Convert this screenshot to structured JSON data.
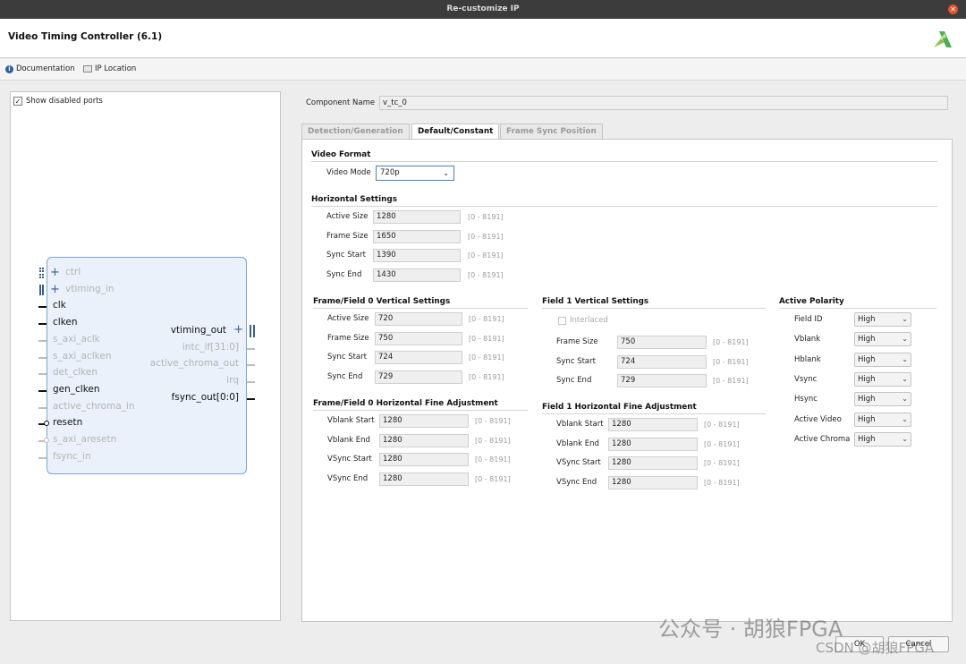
{
  "window": {
    "title": "Re-customize IP",
    "close_glyph": "✕"
  },
  "header": {
    "ip_title": "Video Timing Controller (6.1)"
  },
  "links": {
    "documentation": "Documentation",
    "ip_location": "IP Location",
    "info_glyph": "i"
  },
  "left": {
    "show_disabled_ports": "Show disabled ports",
    "checkbox_glyph": "✓",
    "ports_left": [
      {
        "name": "ctrl",
        "enabled": false,
        "plus": true
      },
      {
        "name": "vtiming_in",
        "enabled": false,
        "plus": true
      },
      {
        "name": "clk",
        "enabled": true
      },
      {
        "name": "clken",
        "enabled": true
      },
      {
        "name": "s_axi_aclk",
        "enabled": false
      },
      {
        "name": "s_axi_aclken",
        "enabled": false
      },
      {
        "name": "det_clken",
        "enabled": false
      },
      {
        "name": "gen_clken",
        "enabled": true
      },
      {
        "name": "active_chroma_in",
        "enabled": false
      },
      {
        "name": "resetn",
        "enabled": true
      },
      {
        "name": "s_axi_aresetn",
        "enabled": false
      },
      {
        "name": "fsync_in",
        "enabled": false
      }
    ],
    "ports_right": [
      {
        "name": "vtiming_out",
        "enabled": true
      },
      {
        "name": "intc_if[31:0]",
        "enabled": false
      },
      {
        "name": "active_chroma_out",
        "enabled": false
      },
      {
        "name": "irq",
        "enabled": false
      },
      {
        "name": "fsync_out[0:0]",
        "enabled": true
      }
    ]
  },
  "component": {
    "label": "Component Name",
    "value": "v_tc_0"
  },
  "tabs": [
    "Detection/Generation",
    "Default/Constant",
    "Frame Sync Position"
  ],
  "video_format": {
    "title": "Video Format",
    "mode_label": "Video Mode",
    "mode_value": "720p"
  },
  "horizontal": {
    "title": "Horizontal Settings",
    "rows": [
      {
        "label": "Active Size",
        "value": "1280",
        "range": "[0 - 8191]"
      },
      {
        "label": "Frame Size",
        "value": "1650",
        "range": "[0 - 8191]"
      },
      {
        "label": "Sync Start",
        "value": "1390",
        "range": "[0 - 8191]"
      },
      {
        "label": "Sync End",
        "value": "1430",
        "range": "[0 - 8191]"
      }
    ]
  },
  "f0_vertical": {
    "title": "Frame/Field 0 Vertical Settings",
    "rows": [
      {
        "label": "Active Size",
        "value": "720",
        "range": "[0 - 8191]"
      },
      {
        "label": "Frame Size",
        "value": "750",
        "range": "[0 - 8191]"
      },
      {
        "label": "Sync Start",
        "value": "724",
        "range": "[0 - 8191]"
      },
      {
        "label": "Sync End",
        "value": "729",
        "range": "[0 - 8191]"
      }
    ]
  },
  "f0_hfine": {
    "title": "Frame/Field 0 Horizontal Fine Adjustment",
    "rows": [
      {
        "label": "Vblank Start",
        "value": "1280",
        "range": "[0 - 8191]"
      },
      {
        "label": "Vblank End",
        "value": "1280",
        "range": "[0 - 8191]"
      },
      {
        "label": "VSync Start",
        "value": "1280",
        "range": "[0 - 8191]"
      },
      {
        "label": "VSync End",
        "value": "1280",
        "range": "[0 - 8191]"
      }
    ]
  },
  "f1_vertical": {
    "title": "Field 1 Vertical Settings",
    "interlaced": "Interlaced",
    "rows": [
      {
        "label": "Frame Size",
        "value": "750",
        "range": "[0 - 8191]"
      },
      {
        "label": "Sync Start",
        "value": "724",
        "range": "[0 - 8191]"
      },
      {
        "label": "Sync End",
        "value": "729",
        "range": "[0 - 8191]"
      }
    ]
  },
  "f1_hfine": {
    "title": "Field 1 Horizontal Fine Adjustment",
    "rows": [
      {
        "label": "Vblank Start",
        "value": "1280",
        "range": "[0 - 8191]"
      },
      {
        "label": "Vblank End",
        "value": "1280",
        "range": "[0 - 8191]"
      },
      {
        "label": "VSync Start",
        "value": "1280",
        "range": "[0 - 8191]"
      },
      {
        "label": "VSync End",
        "value": "1280",
        "range": "[0 - 8191]"
      }
    ]
  },
  "polarity": {
    "title": "Active Polarity",
    "rows": [
      {
        "label": "Field ID",
        "value": "High"
      },
      {
        "label": "Vblank",
        "value": "High"
      },
      {
        "label": "Hblank",
        "value": "High"
      },
      {
        "label": "Vsync",
        "value": "High"
      },
      {
        "label": "Hsync",
        "value": "High"
      },
      {
        "label": "Active Video",
        "value": "High"
      },
      {
        "label": "Active Chroma",
        "value": "High"
      }
    ]
  },
  "buttons": {
    "ok": "OK",
    "cancel": "Cancel"
  },
  "watermark": {
    "line1": "公众号 · 胡狼FPGA",
    "line2": "CSDN @胡狼FPGA"
  },
  "glyphs": {
    "chevron": "⌄",
    "plus": "+"
  }
}
